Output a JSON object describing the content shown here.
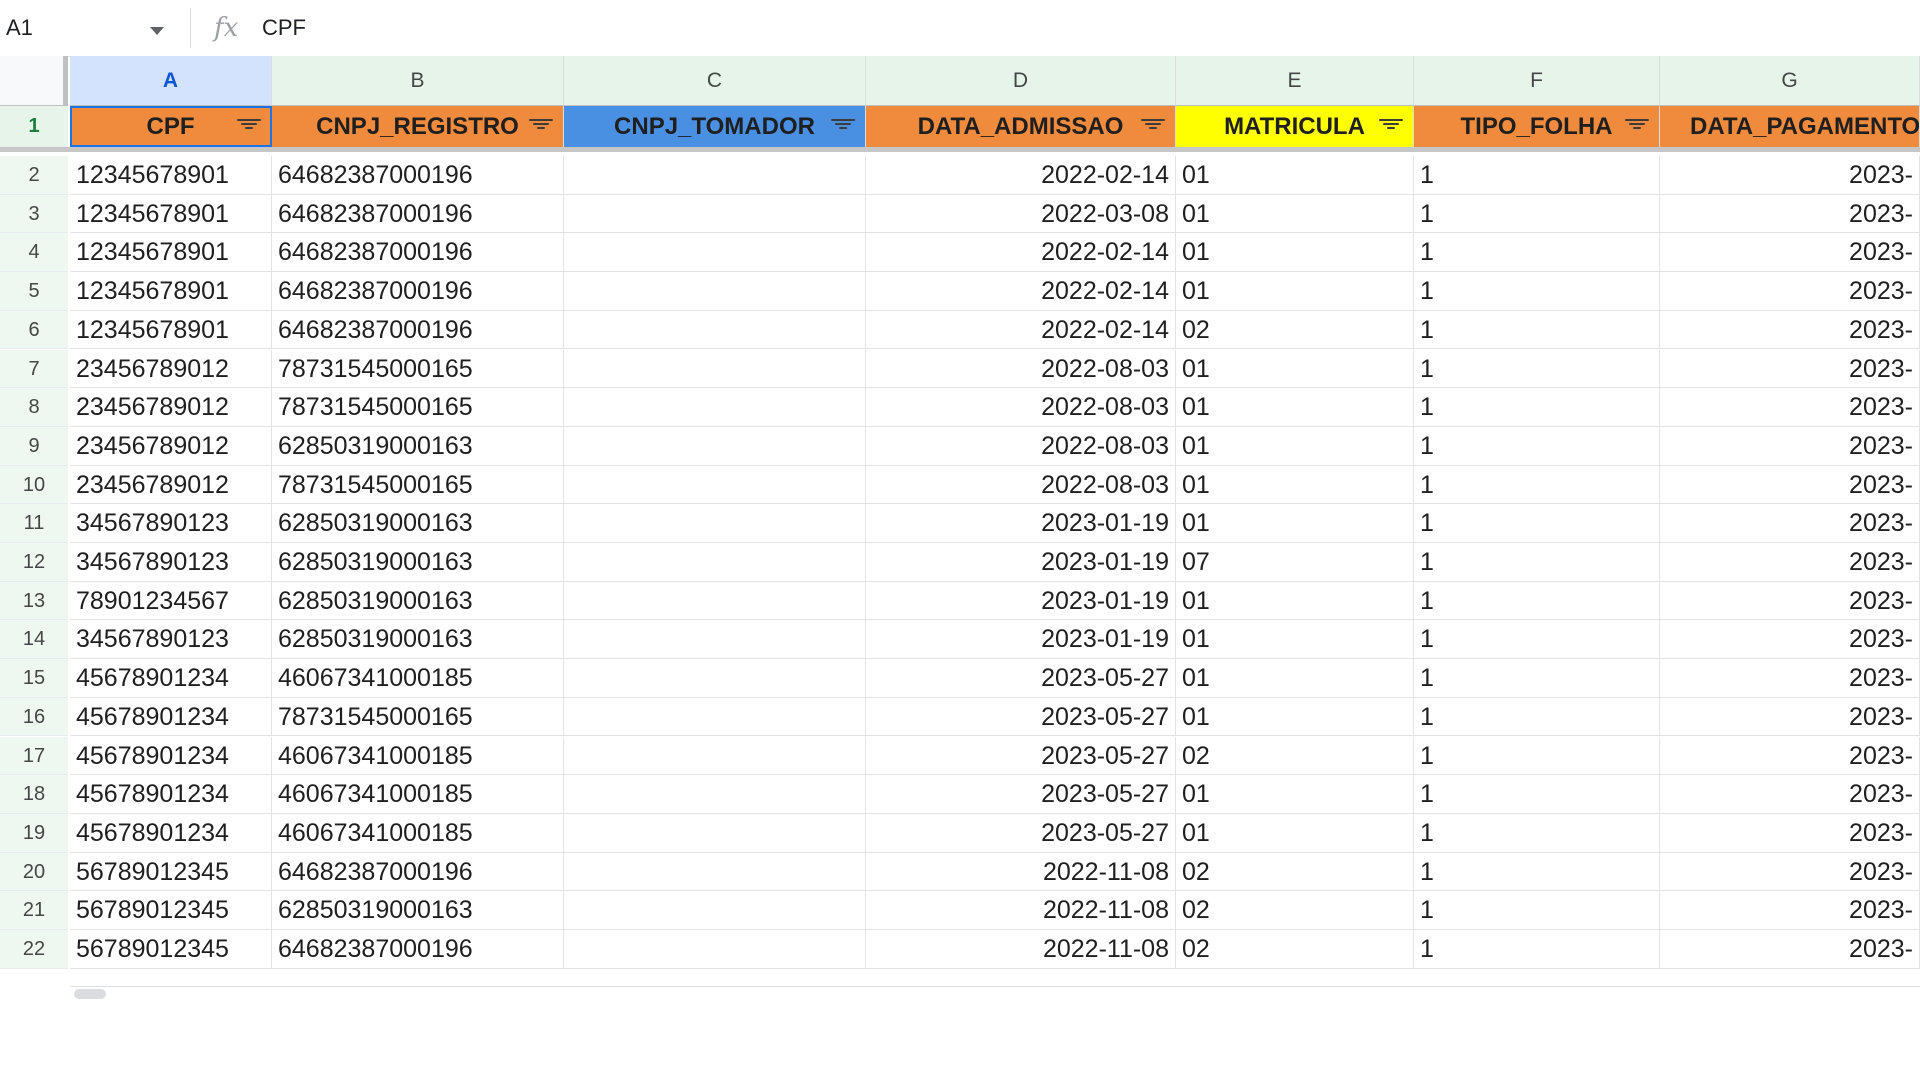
{
  "formula_bar": {
    "name_box": "A1",
    "fx": "fx",
    "formula": "CPF"
  },
  "columns": [
    "A",
    "B",
    "C",
    "D",
    "E",
    "F",
    "G"
  ],
  "header_row_number": "1",
  "headers": [
    {
      "label": "CPF",
      "color": "#f08a3c"
    },
    {
      "label": "CNPJ_REGISTRO",
      "color": "#f08a3c"
    },
    {
      "label": "CNPJ_TOMADOR",
      "color": "#4a90e2"
    },
    {
      "label": "DATA_ADMISSAO",
      "color": "#f08a3c"
    },
    {
      "label": "MATRICULA",
      "color": "#ffff00"
    },
    {
      "label": "TIPO_FOLHA",
      "color": "#f08a3c"
    },
    {
      "label": "DATA_PAGAMENTO",
      "color": "#f08a3c"
    }
  ],
  "rows": [
    {
      "n": "2",
      "cpf": "12345678901",
      "cnpj_registro": "64682387000196",
      "cnpj_tomador": "",
      "data_admissao": "2022-02-14",
      "matricula": "01",
      "tipo_folha": "1",
      "data_pagamento": "2023-"
    },
    {
      "n": "3",
      "cpf": "12345678901",
      "cnpj_registro": "64682387000196",
      "cnpj_tomador": "",
      "data_admissao": "2022-03-08",
      "matricula": "01",
      "tipo_folha": "1",
      "data_pagamento": "2023-"
    },
    {
      "n": "4",
      "cpf": "12345678901",
      "cnpj_registro": "64682387000196",
      "cnpj_tomador": "",
      "data_admissao": "2022-02-14",
      "matricula": "01",
      "tipo_folha": "1",
      "data_pagamento": "2023-"
    },
    {
      "n": "5",
      "cpf": "12345678901",
      "cnpj_registro": "64682387000196",
      "cnpj_tomador": "",
      "data_admissao": "2022-02-14",
      "matricula": "01",
      "tipo_folha": "1",
      "data_pagamento": "2023-"
    },
    {
      "n": "6",
      "cpf": "12345678901",
      "cnpj_registro": "64682387000196",
      "cnpj_tomador": "",
      "data_admissao": "2022-02-14",
      "matricula": "02",
      "tipo_folha": "1",
      "data_pagamento": "2023-"
    },
    {
      "n": "7",
      "cpf": "23456789012",
      "cnpj_registro": "78731545000165",
      "cnpj_tomador": "",
      "data_admissao": "2022-08-03",
      "matricula": "01",
      "tipo_folha": "1",
      "data_pagamento": "2023-"
    },
    {
      "n": "8",
      "cpf": "23456789012",
      "cnpj_registro": "78731545000165",
      "cnpj_tomador": "",
      "data_admissao": "2022-08-03",
      "matricula": "01",
      "tipo_folha": "1",
      "data_pagamento": "2023-"
    },
    {
      "n": "9",
      "cpf": "23456789012",
      "cnpj_registro": "62850319000163",
      "cnpj_tomador": "",
      "data_admissao": "2022-08-03",
      "matricula": "01",
      "tipo_folha": "1",
      "data_pagamento": "2023-"
    },
    {
      "n": "10",
      "cpf": "23456789012",
      "cnpj_registro": "78731545000165",
      "cnpj_tomador": "",
      "data_admissao": "2022-08-03",
      "matricula": "01",
      "tipo_folha": "1",
      "data_pagamento": "2023-"
    },
    {
      "n": "11",
      "cpf": "34567890123",
      "cnpj_registro": "62850319000163",
      "cnpj_tomador": "",
      "data_admissao": "2023-01-19",
      "matricula": "01",
      "tipo_folha": "1",
      "data_pagamento": "2023-"
    },
    {
      "n": "12",
      "cpf": "34567890123",
      "cnpj_registro": "62850319000163",
      "cnpj_tomador": "",
      "data_admissao": "2023-01-19",
      "matricula": "07",
      "tipo_folha": "1",
      "data_pagamento": "2023-"
    },
    {
      "n": "13",
      "cpf": "78901234567",
      "cnpj_registro": "62850319000163",
      "cnpj_tomador": "",
      "data_admissao": "2023-01-19",
      "matricula": "01",
      "tipo_folha": "1",
      "data_pagamento": "2023-"
    },
    {
      "n": "14",
      "cpf": "34567890123",
      "cnpj_registro": "62850319000163",
      "cnpj_tomador": "",
      "data_admissao": "2023-01-19",
      "matricula": "01",
      "tipo_folha": "1",
      "data_pagamento": "2023-"
    },
    {
      "n": "15",
      "cpf": "45678901234",
      "cnpj_registro": "46067341000185",
      "cnpj_tomador": "",
      "data_admissao": "2023-05-27",
      "matricula": "01",
      "tipo_folha": "1",
      "data_pagamento": "2023-"
    },
    {
      "n": "16",
      "cpf": "45678901234",
      "cnpj_registro": "78731545000165",
      "cnpj_tomador": "",
      "data_admissao": "2023-05-27",
      "matricula": "01",
      "tipo_folha": "1",
      "data_pagamento": "2023-"
    },
    {
      "n": "17",
      "cpf": "45678901234",
      "cnpj_registro": "46067341000185",
      "cnpj_tomador": "",
      "data_admissao": "2023-05-27",
      "matricula": "02",
      "tipo_folha": "1",
      "data_pagamento": "2023-"
    },
    {
      "n": "18",
      "cpf": "45678901234",
      "cnpj_registro": "46067341000185",
      "cnpj_tomador": "",
      "data_admissao": "2023-05-27",
      "matricula": "01",
      "tipo_folha": "1",
      "data_pagamento": "2023-"
    },
    {
      "n": "19",
      "cpf": "45678901234",
      "cnpj_registro": "46067341000185",
      "cnpj_tomador": "",
      "data_admissao": "2023-05-27",
      "matricula": "01",
      "tipo_folha": "1",
      "data_pagamento": "2023-"
    },
    {
      "n": "20",
      "cpf": "56789012345",
      "cnpj_registro": "64682387000196",
      "cnpj_tomador": "",
      "data_admissao": "2022-11-08",
      "matricula": "02",
      "tipo_folha": "1",
      "data_pagamento": "2023-"
    },
    {
      "n": "21",
      "cpf": "56789012345",
      "cnpj_registro": "62850319000163",
      "cnpj_tomador": "",
      "data_admissao": "2022-11-08",
      "matricula": "02",
      "tipo_folha": "1",
      "data_pagamento": "2023-"
    },
    {
      "n": "22",
      "cpf": "56789012345",
      "cnpj_registro": "64682387000196",
      "cnpj_tomador": "",
      "data_admissao": "2022-11-08",
      "matricula": "02",
      "tipo_folha": "1",
      "data_pagamento": "2023-"
    }
  ]
}
